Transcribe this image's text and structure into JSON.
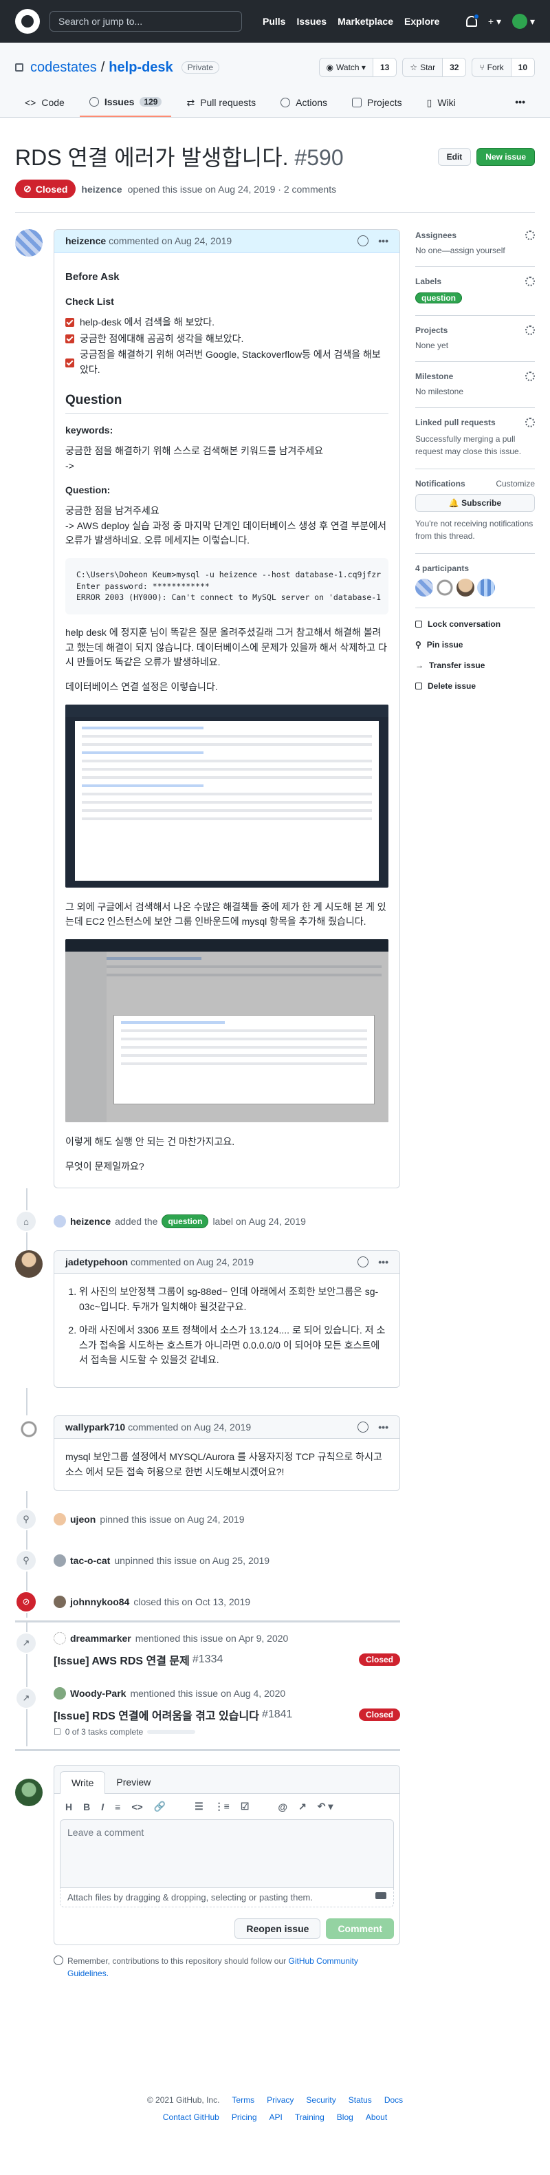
{
  "header": {
    "search_placeholder": "Search or jump to...",
    "nav": [
      "Pulls",
      "Issues",
      "Marketplace",
      "Explore"
    ],
    "plus": "+ ▾",
    "avatar_caret": "▾"
  },
  "repo": {
    "owner": "codestates",
    "slash": "/",
    "name": "help-desk",
    "visibility": "Private",
    "watch": {
      "label": "Watch ▾",
      "count": "13"
    },
    "star": {
      "label": "Star",
      "count": "32"
    },
    "fork": {
      "label": "Fork",
      "count": "10"
    },
    "tabs": [
      {
        "label": "Code"
      },
      {
        "label": "Issues",
        "count": "129"
      },
      {
        "label": "Pull requests"
      },
      {
        "label": "Actions"
      },
      {
        "label": "Projects"
      },
      {
        "label": "Wiki"
      }
    ],
    "more": "•••"
  },
  "issue": {
    "title": "RDS 연결 에러가 발생합니다.",
    "number": "#590",
    "edit": "Edit",
    "new_issue": "New issue",
    "state": "Closed",
    "author": "heizence",
    "opened_text": "opened this issue on Aug 24, 2019 · 2 comments"
  },
  "comments": [
    {
      "author": "heizence",
      "when": "commented on Aug 24, 2019",
      "more": "•••",
      "h_before": "Before Ask",
      "h_check": "Check List",
      "checks": [
        "help-desk 에서 검색을 해 보았다.",
        "궁금한 점에대해 곰곰히 생각을 해보았다.",
        "궁금점을 해결하기 위해 여러번 Google, Stackoverflow등 에서 검색을 해보았다."
      ],
      "h_question": "Question",
      "h_keywords": "keywords:",
      "kw_text1": "궁금한 점을 해결하기 위해 스스로 검색해본 키워드를 남겨주세요",
      "kw_text2": "->",
      "h_question2": "Question:",
      "q_text1": "궁금한 점을 남겨주세요",
      "q_text2": "-> AWS deploy 실습 과정 중 마지막 단계인 데이터베이스 생성 후 연결 부분에서 오류가 발생하네요. 오류 메세지는 이렇습니다.",
      "code": "C:\\Users\\Doheon Keum>mysql -u heizence --host database-1.cq9jfzr\nEnter password: ************\nERROR 2003 (HY000): Can't connect to MySQL server on 'database-1",
      "p1": "help desk 에 정지훈 님이 똑같은 질문 올려주셨길래 그거 참고해서 해결해 볼려고 했는데 해결이 되지 않습니다. 데이터베이스에 문제가 있을까 해서 삭제하고 다시 만들어도 똑같은 오류가 발생하네요.",
      "p2": "데이터베이스 연결 설정은 이렇습니다.",
      "p3": "그 외에 구글에서 검색해서 나온 수많은 해결책들 중에 제가 한 게 시도해 본 게 있는데 EC2 인스턴스에 보안 그룹 인바운드에 mysql 항목을 추가해 줬습니다.",
      "p4": "이렇게 해도 실행 안 되는 건 마찬가지고요.",
      "p5": "무엇이 문제일까요?"
    },
    {
      "author": "jadetypehoon",
      "when": "commented on Aug 24, 2019",
      "more": "•••",
      "items": [
        "위 사진의 보안정책 그룹이 sg-88ed~ 인데 아래에서 조회한 보안그룹은 sg-03c~입니다. 두개가 일치해야 될것같구요.",
        "아래 사진에서 3306 포트 정책에서 소스가 13.124.... 로 되어 있습니다. 저 소스가 접속을 시도하는 호스트가 아니라면 0.0.0.0/0 이 되어야 모든 호스트에서 접속을 시도할 수 있을것 같네요."
      ]
    },
    {
      "author": "wallypark710",
      "when": "commented on Aug 24, 2019",
      "more": "•••",
      "text": "mysql 보안그룹 설정에서 MYSQL/Aurora 를 사용자지정 TCP 규칙으로 하시고 소스 에서 모든 접속 허용으로 한번 시도해보시겠어요?!"
    }
  ],
  "events": [
    {
      "icon": "tag-icon",
      "actor": "heizence",
      "action": "added the",
      "label": "question",
      "suffix": "label on Aug 24, 2019"
    },
    {
      "icon": "pin-icon",
      "actor": "ujeon",
      "action": "pinned this issue on Aug 24, 2019"
    },
    {
      "icon": "unpin-icon",
      "actor": "tac-o-cat",
      "action": "unpinned this issue on Aug 25, 2019"
    },
    {
      "icon": "closed-icon",
      "actor": "johnnykoo84",
      "action": "closed this on Oct 13, 2019"
    }
  ],
  "xrefs": [
    {
      "actor": "dreammarker",
      "action": "mentioned this issue on Apr 9, 2020",
      "title": "[Issue] AWS RDS 연결 문제",
      "number": "#1334",
      "state": "Closed"
    },
    {
      "actor": "Woody-Park",
      "action": "mentioned this issue on Aug 4, 2020",
      "title": "[Issue] RDS 연결에 어려움을 겪고 있습니다",
      "number": "#1841",
      "state": "Closed",
      "tasks": "0 of 3 tasks complete"
    }
  ],
  "composer": {
    "tab_write": "Write",
    "tab_preview": "Preview",
    "tools": [
      "H",
      "B",
      "I",
      "≡",
      "<>",
      "🔗",
      "☰",
      "⋮≡",
      "☑",
      "@",
      "↗",
      "↶ ▾"
    ],
    "placeholder": "Leave a comment",
    "attach": "Attach files by dragging & dropping, selecting or pasting them.",
    "reopen": "Reopen issue",
    "comment": "Comment"
  },
  "reminder": {
    "text": "Remember, contributions to this repository should follow our",
    "link": "GitHub Community Guidelines."
  },
  "sidebar": {
    "assignees": {
      "title": "Assignees",
      "value": "No one—assign yourself"
    },
    "labels": {
      "title": "Labels",
      "value": "question"
    },
    "projects": {
      "title": "Projects",
      "value": "None yet"
    },
    "milestone": {
      "title": "Milestone",
      "value": "No milestone"
    },
    "linked": {
      "title": "Linked pull requests",
      "value": "Successfully merging a pull request may close this issue."
    },
    "notifications": {
      "title": "Notifications",
      "customize": "Customize",
      "button": "Subscribe",
      "value": "You're not receiving notifications from this thread."
    },
    "participants": {
      "title": "4 participants"
    },
    "actions": [
      "Lock conversation",
      "Pin issue",
      "Transfer issue",
      "Delete issue"
    ]
  },
  "footer": {
    "copyright": "© 2021 GitHub, Inc.",
    "row1": [
      "Terms",
      "Privacy",
      "Security",
      "Status",
      "Docs"
    ],
    "row2": [
      "Contact GitHub",
      "Pricing",
      "API",
      "Training",
      "Blog",
      "About"
    ]
  }
}
